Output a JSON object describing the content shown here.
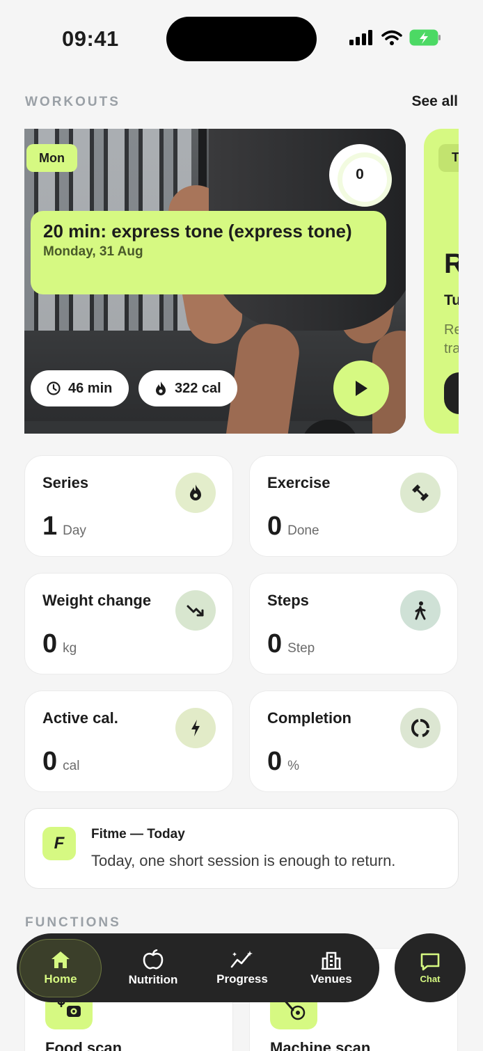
{
  "status": {
    "time": "09:41"
  },
  "workouts": {
    "section_label": "WORKOUTS",
    "see_all": "See all",
    "card": {
      "day": "Mon",
      "progress": "0",
      "title": "20 min: express tone (express tone)",
      "date": "Monday, 31 Aug",
      "duration": "46 min",
      "calories": "322 cal"
    },
    "next_card": {
      "day": "T",
      "title": "R",
      "subtitle": "Tu",
      "desc_line1": "Re",
      "desc_line2": "tra"
    }
  },
  "stats": [
    {
      "title": "Series",
      "value": "1",
      "unit": "Day",
      "icon": "flame-icon"
    },
    {
      "title": "Exercise",
      "value": "0",
      "unit": "Done",
      "icon": "dumbbell-icon"
    },
    {
      "title": "Weight change",
      "value": "0",
      "unit": "kg",
      "icon": "trend-down-icon"
    },
    {
      "title": "Steps",
      "value": "0",
      "unit": "Step",
      "icon": "walking-icon"
    },
    {
      "title": "Active cal.",
      "value": "0",
      "unit": "cal",
      "icon": "bolt-icon"
    },
    {
      "title": "Completion",
      "value": "0",
      "unit": "%",
      "icon": "ring-icon"
    }
  ],
  "tip": {
    "logo": "F",
    "title": "Fitme — Today",
    "text": "Today, one short session is enough to return."
  },
  "functions": {
    "section_label": "FUNCTIONS",
    "items": [
      {
        "title": "Food scan"
      },
      {
        "title": "Machine scan"
      }
    ]
  },
  "nav": {
    "items": [
      {
        "label": "Home"
      },
      {
        "label": "Nutrition"
      },
      {
        "label": "Progress"
      },
      {
        "label": "Venues"
      }
    ],
    "chat": "Chat"
  },
  "colors": {
    "accent": "#d6f982",
    "nav_bg": "#252525",
    "page_bg": "#f5f5f5"
  }
}
